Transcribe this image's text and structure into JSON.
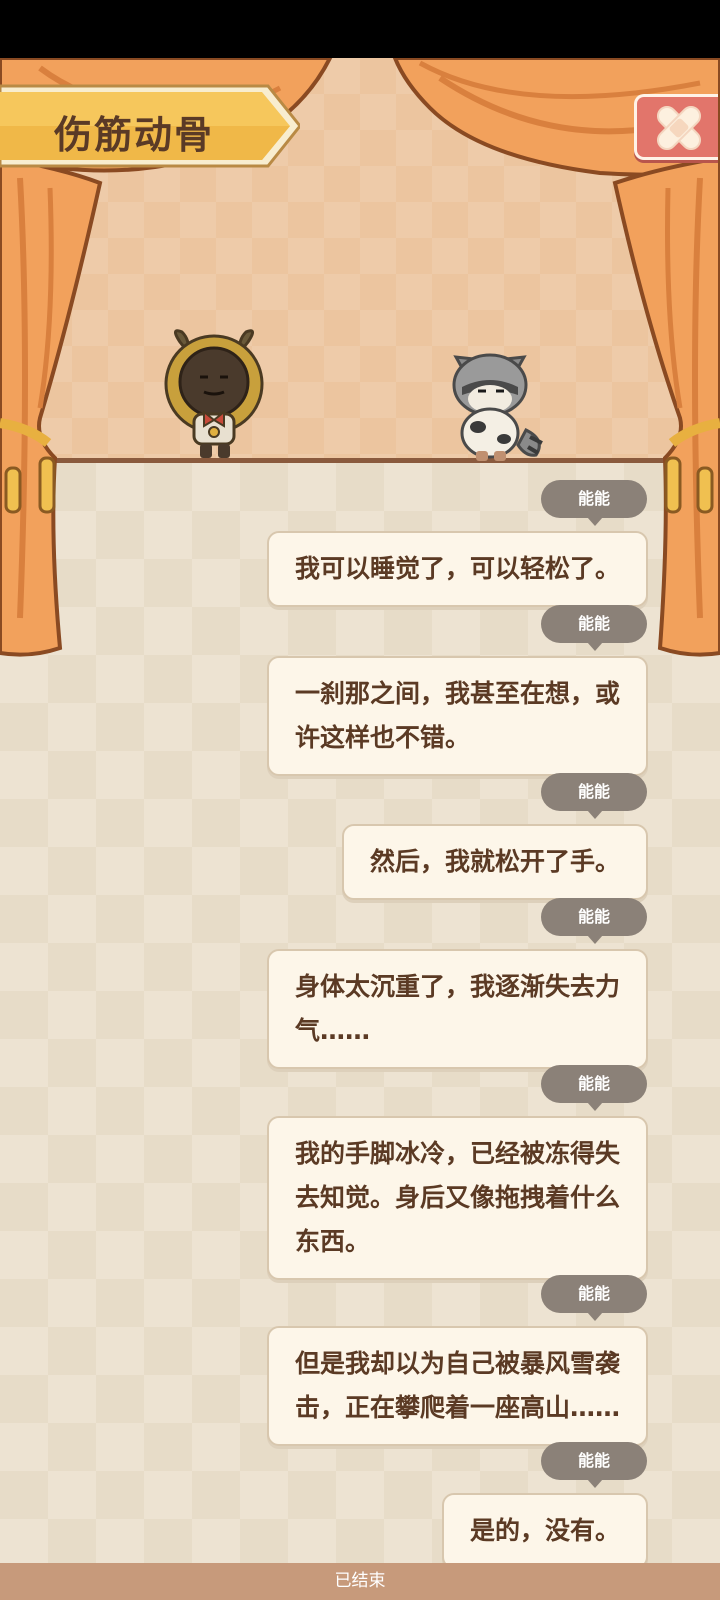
{
  "header": {
    "title": "伤筋动骨"
  },
  "icons": {
    "close": "bandage-cross-icon"
  },
  "colors": {
    "stage": "#ecc59f",
    "curtain": "#f2a15c",
    "curtain_dark": "#c9703a",
    "banner": "#f6c75c",
    "close_button": "#e2756b",
    "speaker_tag": "#8b8178",
    "bubble": "#fdf6e9",
    "text": "#5b3a24",
    "footer": "#c79a7b"
  },
  "messages": [
    {
      "speaker": "能能",
      "text": "我可以睡觉了，可以轻松了。"
    },
    {
      "speaker": "能能",
      "text": "一刹那之间，我甚至在想，或\n许这样也不错。"
    },
    {
      "speaker": "能能",
      "text": "然后，我就松开了手。"
    },
    {
      "speaker": "能能",
      "text": "身体太沉重了，我逐渐失去力\n气……"
    },
    {
      "speaker": "能能",
      "text": "我的手脚冰冷，已经被冻得失\n去知觉。身后又像拖拽着什么\n东西。"
    },
    {
      "speaker": "能能",
      "text": "但是我却以为自己被暴风雪袭\n击，正在攀爬着一座高山……"
    },
    {
      "speaker": "能能",
      "text": "是的，没有。"
    }
  ],
  "footer": {
    "status": "已结束"
  }
}
